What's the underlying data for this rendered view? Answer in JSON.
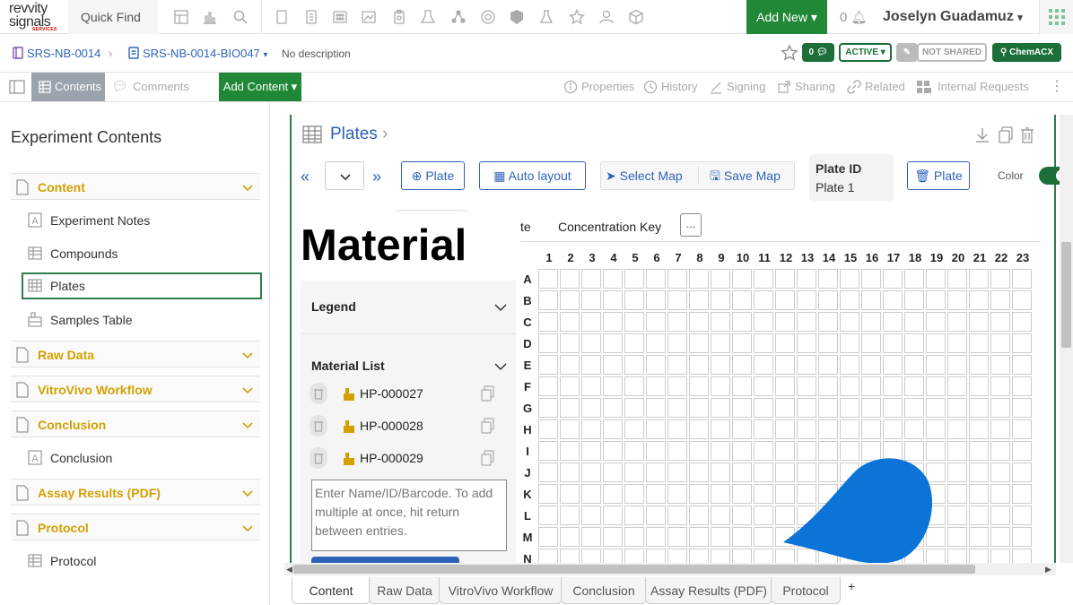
{
  "app": {
    "logo_line1": "revvity",
    "logo_line2": "signals",
    "logo_line3": "SERVICES",
    "quick_find": "Quick Find",
    "add_new": "Add New",
    "notif_count": "0",
    "user": "Joselyn Guadamuz"
  },
  "breadcrumb": {
    "notebook": "SRS-NB-0014",
    "experiment": "SRS-NB-0014-BIO047",
    "description": "No description",
    "comment_count": "0",
    "status": "ACTIVE",
    "sharing": "NOT SHARED",
    "chemacx": "ChemACX"
  },
  "toolbar": {
    "contents": "Contents",
    "comments": "Comments",
    "add_content": "Add Content",
    "properties": "Properties",
    "history": "History",
    "signing": "Signing",
    "sharing": "Sharing",
    "related": "Related",
    "internal_requests": "Internal Requests"
  },
  "sidebar": {
    "title": "Experiment Contents",
    "sections": {
      "content": "Content",
      "raw_data": "Raw Data",
      "vitrovivo": "VitroVivo Workflow",
      "conclusion": "Conclusion",
      "assay": "Assay Results (PDF)",
      "protocol": "Protocol"
    },
    "items": {
      "notes": "Experiment Notes",
      "compounds": "Compounds",
      "plates": "Plates",
      "samples": "Samples Table",
      "conclusion": "Conclusion",
      "protocol": "Protocol"
    }
  },
  "plates": {
    "title": "Plates",
    "plate_btn": "Plate",
    "auto_layout": "Auto layout",
    "select_map": "Select Map",
    "save_map": "Save Map",
    "plate_id_label": "Plate ID",
    "plate_id_value": "Plate 1",
    "plate_btn2": "Plate",
    "color_label": "Color",
    "material_title": "Material",
    "legend": "Legend",
    "material_list": "Material List",
    "materials": [
      "HP-000027",
      "HP-000028",
      "HP-000029"
    ],
    "input_placeholder": "Enter Name/ID/Barcode. To add multiple at once, hit return between entries.",
    "tab_partial": "te",
    "concentration_key": "Concentration Key",
    "more": "...",
    "columns": [
      "1",
      "2",
      "3",
      "4",
      "5",
      "6",
      "7",
      "8",
      "9",
      "10",
      "11",
      "12",
      "13",
      "14",
      "15",
      "16",
      "17",
      "18",
      "19",
      "20",
      "21",
      "22",
      "23"
    ],
    "rows": [
      "A",
      "B",
      "C",
      "D",
      "E",
      "F",
      "G",
      "H",
      "I",
      "J",
      "K",
      "L",
      "M",
      "N"
    ]
  },
  "bottom_tabs": [
    "Content",
    "Raw Data",
    "VitroVivo Workflow",
    "Conclusion",
    "Assay Results (PDF)",
    "Protocol",
    "+"
  ],
  "colors": {
    "green": "#218838",
    "blue": "#2e63b8",
    "gold": "#d4a000",
    "blob": "#0b74d6"
  }
}
